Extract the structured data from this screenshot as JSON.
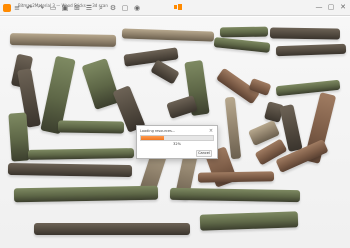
{
  "window": {
    "title": "Bitmap2Material 3 — Wood Sticks — 3d scan",
    "minimize": "—",
    "maximize": "▢",
    "close": "✕"
  },
  "toolbar": {
    "icons": [
      "menu-icon",
      "undo-icon",
      "redo-icon",
      "folder-icon",
      "save-icon",
      "grid-icon",
      "layers-icon",
      "zoom-icon",
      "settings-icon",
      "image-icon",
      "camera-icon"
    ]
  },
  "dialog": {
    "title": "Loading resources...",
    "close_glyph": "×",
    "progress": 0.32,
    "progress_text": "32%",
    "button_label": "Cancel",
    "accent": "#f07822"
  }
}
